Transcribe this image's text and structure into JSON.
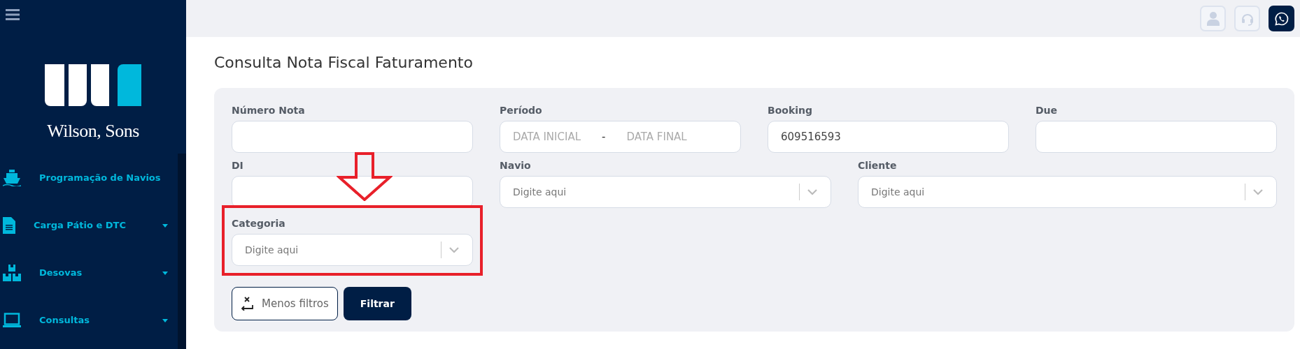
{
  "sidebar": {
    "brand": "Wilson, Sons",
    "items": [
      {
        "label": "Programação de Navios",
        "has_submenu": false
      },
      {
        "label": "Carga Pátio e DTC",
        "has_submenu": true
      },
      {
        "label": "Desovas",
        "has_submenu": true
      },
      {
        "label": "Consultas",
        "has_submenu": true
      }
    ]
  },
  "page": {
    "title": "Consulta Nota Fiscal Faturamento"
  },
  "filters": {
    "rows": [
      [
        {
          "kind": "text",
          "label": "Número Nota",
          "highlighted": false
        },
        {
          "kind": "daterange",
          "label": "Período",
          "start_placeholder": "DATA INICIAL",
          "separator": "-",
          "end_placeholder": "DATA FINAL",
          "highlighted": false
        },
        {
          "kind": "text",
          "label": "Booking",
          "value": "609516593",
          "highlighted": false
        },
        {
          "kind": "text",
          "label": "Due",
          "highlighted": false
        }
      ],
      [
        {
          "kind": "text",
          "label": "DI",
          "highlighted": false
        },
        {
          "kind": "select",
          "label": "Navio",
          "placeholder": "Digite aqui",
          "highlighted": false
        },
        {
          "kind": "select",
          "label": "Cliente",
          "placeholder": "Digite aqui",
          "highlighted": false
        }
      ],
      [
        {
          "kind": "select",
          "label": "Categoria",
          "placeholder": "Digite aqui",
          "highlighted": true
        }
      ]
    ],
    "buttons": [
      {
        "kind": "outline",
        "label": "Menos filtros"
      },
      {
        "kind": "primary",
        "label": "Filtrar"
      }
    ]
  }
}
